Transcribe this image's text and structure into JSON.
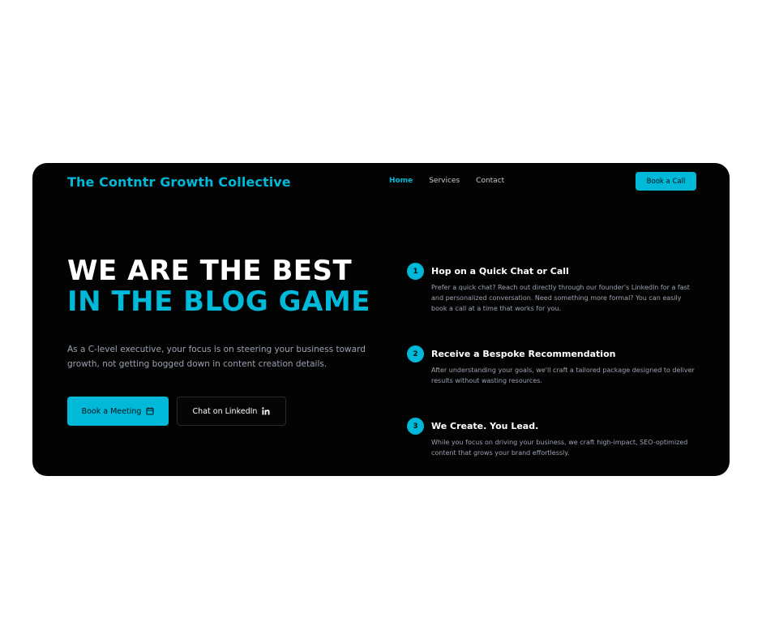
{
  "header": {
    "brand": "The Contntr Growth Collective",
    "nav": [
      {
        "label": "Home",
        "active": true
      },
      {
        "label": "Services",
        "active": false
      },
      {
        "label": "Contact",
        "active": false
      }
    ],
    "cta_label": "Book a Call"
  },
  "hero": {
    "line1": "WE ARE THE BEST",
    "line2": "IN THE BLOG GAME",
    "intro": "As a C-level executive, your focus is on steering your business toward growth, not getting bogged down in content creation details.",
    "primary_button": {
      "label": "Book a Meeting",
      "icon": "calendar-icon"
    },
    "secondary_button": {
      "label": "Chat on LinkedIn",
      "icon": "linkedin-icon"
    }
  },
  "steps": [
    {
      "number": "1",
      "title": "Hop on a Quick Chat or Call",
      "description": "Prefer a quick chat? Reach out directly through our founder's LinkedIn for a fast and personalized conversation. Need something more formal? You can easily book a call at a time that works for you."
    },
    {
      "number": "2",
      "title": "Receive a Bespoke Recommendation",
      "description": "After understanding your goals, we'll craft a tailored package designed to deliver results without wasting resources."
    },
    {
      "number": "3",
      "title": "We Create. You Lead.",
      "description": "While you focus on driving your business, we craft high-impact, SEO-optimized content that grows your brand effortlessly."
    }
  ],
  "colors": {
    "accent": "#00b8d8",
    "background": "#030303",
    "page": "#ffffff",
    "body_text": "#9aa3b0"
  }
}
